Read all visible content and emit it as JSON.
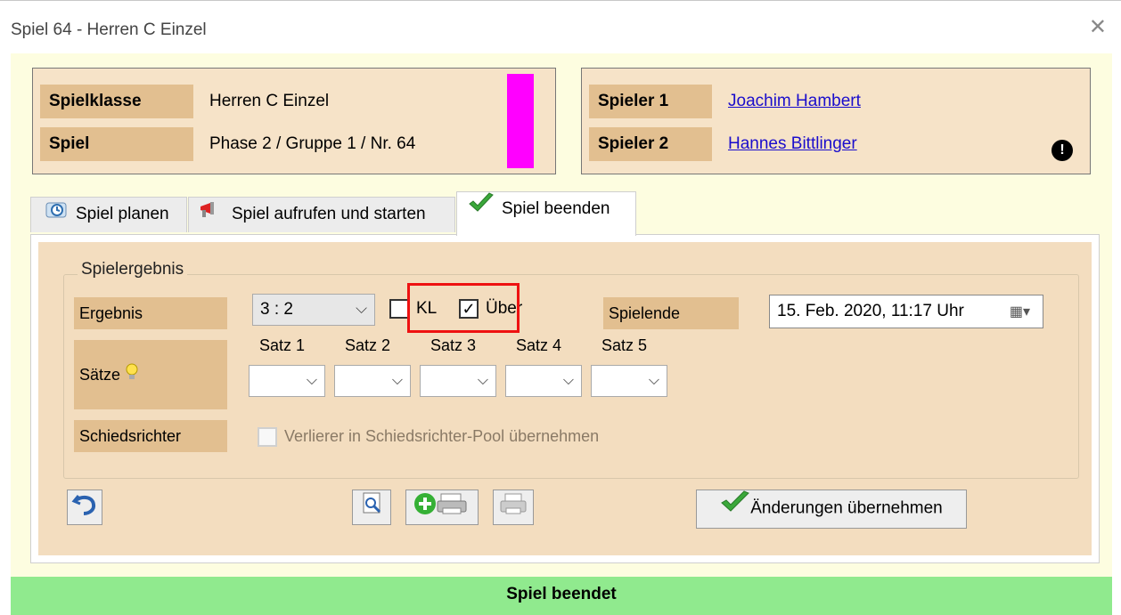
{
  "window": {
    "title": "Spiel 64 - Herren C Einzel",
    "close_glyph": "✕"
  },
  "match_info": {
    "spielklasse_label": "Spielklasse",
    "spielklasse_value": "Herren C Einzel",
    "spiel_label": "Spiel",
    "spiel_value": "Phase 2 / Gruppe 1 / Nr. 64",
    "color_marker": "#ff00ff"
  },
  "players": {
    "spieler1_label": "Spieler 1",
    "spieler1_name": "Joachim Hambert",
    "spieler2_label": "Spieler 2",
    "spieler2_name": "Hannes Bittlinger",
    "warning_icon": "exclamation-icon",
    "warning_glyph": "!"
  },
  "tabs": [
    {
      "label": "Spiel planen",
      "icon": "clock-icon",
      "active": false
    },
    {
      "label": "Spiel aufrufen und starten",
      "icon": "megaphone-icon",
      "active": false
    },
    {
      "label": "Spiel beenden",
      "icon": "checkmark-icon",
      "active": true
    }
  ],
  "result_group": {
    "title": "Spielergebnis",
    "ergebnis_label": "Ergebnis",
    "ergebnis_value": "3 : 2",
    "kl_label": "KL",
    "kl_checked": false,
    "ueber_label": "Über",
    "ueber_checked": true,
    "spielende_label": "Spielende",
    "spielende_value": "15. Feb. 2020, 11:17 Uhr",
    "saetze_label": "Sätze",
    "satz_labels": [
      "Satz 1",
      "Satz 2",
      "Satz 3",
      "Satz 4",
      "Satz 5"
    ],
    "schiedsrichter_label": "Schiedsrichter",
    "schiedsrichter_option": "Verlierer in Schiedsrichter-Pool übernehmen",
    "schiedsrichter_checked": false
  },
  "actions": {
    "undo_icon": "undo-icon",
    "preview_icon": "print-preview-icon",
    "add_print_icon": "add-print-icon",
    "print_icon": "printer-icon",
    "apply_label": "Änderungen übernehmen"
  },
  "status": {
    "text": "Spiel beendet",
    "color": "#90ea8e"
  },
  "colors": {
    "label_bg": "#e2bf90",
    "panel_bg": "#f3ddbf",
    "client_bg": "#fdfde0",
    "highlight_border": "#e11111"
  }
}
